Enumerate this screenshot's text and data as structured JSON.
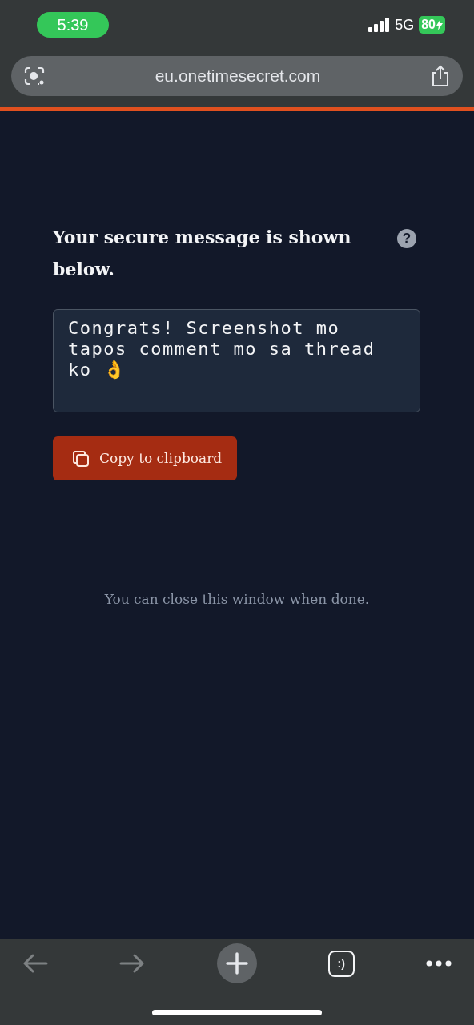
{
  "status_bar": {
    "time": "5:39",
    "network": "5G",
    "battery": "80"
  },
  "browser": {
    "url": "eu.onetimesecret.com"
  },
  "page": {
    "help_icon": "?",
    "heading": "Your secure message is shown below.",
    "message": "Congrats! Screenshot mo tapos comment mo sa thread ko 👌",
    "copy_button": "Copy to clipboard",
    "footer_note": "You can close this window when done."
  },
  "toolbar": {
    "back_disabled": true,
    "forward_disabled": true,
    "tab_icon_text": ":)"
  }
}
